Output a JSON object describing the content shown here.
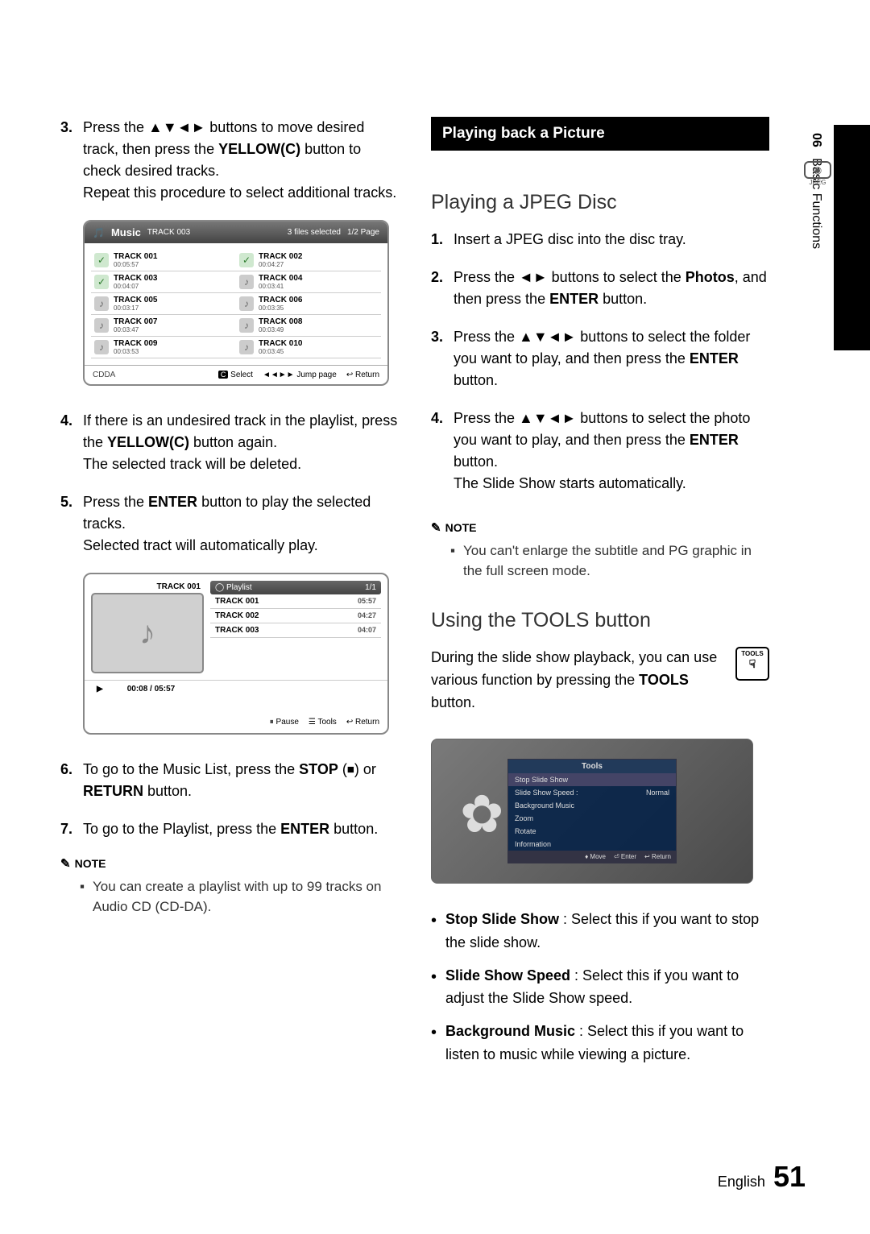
{
  "side": {
    "chapter": "06",
    "title": "Basic Functions"
  },
  "left": {
    "steps": [
      {
        "n": "3.",
        "html": "Press the ▲▼◄► buttons to move desired track, then press the <b>YELLOW(C)</b> button to check desired tracks.<br>Repeat this procedure to select additional tracks."
      },
      {
        "n": "4.",
        "html": "If there is an undesired track in the playlist, press the <b>YELLOW(C)</b> button again.<br>The selected track will be deleted."
      },
      {
        "n": "5.",
        "html": "Press the <b>ENTER</b> button to play the selected tracks.<br>Selected tract will automatically play."
      },
      {
        "n": "6.",
        "html": "To go to the Music List, press the <b>STOP</b> (⏹) or <b>RETURN</b> button."
      },
      {
        "n": "7.",
        "html": "To go to the Playlist, press the <b>ENTER</b> button."
      }
    ],
    "fig1": {
      "music": "Music",
      "cur": "TRACK 003",
      "sel": "3 files selected",
      "page": "1/2 Page",
      "tracks": [
        {
          "n": "TRACK 001",
          "t": "00:05:57",
          "c": true
        },
        {
          "n": "TRACK 002",
          "t": "00:04:27",
          "c": true
        },
        {
          "n": "TRACK 003",
          "t": "00:04:07",
          "c": true
        },
        {
          "n": "TRACK 004",
          "t": "00:03:41",
          "c": false
        },
        {
          "n": "TRACK 005",
          "t": "00:03:17",
          "c": false
        },
        {
          "n": "TRACK 006",
          "t": "00:03:35",
          "c": false
        },
        {
          "n": "TRACK 007",
          "t": "00:03:47",
          "c": false
        },
        {
          "n": "TRACK 008",
          "t": "00:03:49",
          "c": false
        },
        {
          "n": "TRACK 009",
          "t": "00:03:53",
          "c": false
        },
        {
          "n": "TRACK 010",
          "t": "00:03:45",
          "c": false
        }
      ],
      "cdda": "CDDA",
      "select": "Select",
      "jump": "Jump page",
      "ret": "Return"
    },
    "fig2": {
      "cur": "TRACK 001",
      "pl_hdr": "Playlist",
      "pl_page": "1/1",
      "items": [
        {
          "n": "TRACK 001",
          "t": "05:57"
        },
        {
          "n": "TRACK 002",
          "t": "04:27"
        },
        {
          "n": "TRACK 003",
          "t": "04:07"
        }
      ],
      "play_time": "00:08 / 05:57",
      "pause": "Pause",
      "tools": "Tools",
      "ret": "Return"
    },
    "note_hdr": "NOTE",
    "note": "You can create a playlist with up to 99 tracks on Audio CD (CD-DA)."
  },
  "right": {
    "bar": "Playing back a Picture",
    "jpeg_lbl": "JPEG",
    "h1": "Playing a JPEG Disc",
    "steps": [
      {
        "n": "1.",
        "html": "Insert a JPEG disc into the disc tray."
      },
      {
        "n": "2.",
        "html": "Press the ◄► buttons to select the <b>Photos</b>, and then press the <b>ENTER</b> button."
      },
      {
        "n": "3.",
        "html": "Press the ▲▼◄► buttons to select the folder you want to play, and then press the <b>ENTER</b> button."
      },
      {
        "n": "4.",
        "html": "Press the ▲▼◄► buttons to select the photo you want to play, and then press the <b>ENTER</b> button.<br>The Slide Show starts automatically."
      }
    ],
    "note_hdr": "NOTE",
    "note": "You can't enlarge the subtitle and PG graphic in the full screen mode.",
    "h2": "Using the TOOLS button",
    "tools_btn": "TOOLS",
    "para": "During the slide show playback, you can use various function by pressing the <b>TOOLS</b> button.",
    "fig3": {
      "hdr": "Tools",
      "items": [
        {
          "l": "Stop Slide Show",
          "r": ""
        },
        {
          "l": "Slide Show Speed :",
          "r": "Normal"
        },
        {
          "l": "Background Music",
          "r": ""
        },
        {
          "l": "Zoom",
          "r": ""
        },
        {
          "l": "Rotate",
          "r": ""
        },
        {
          "l": "Information",
          "r": ""
        }
      ],
      "move": "Move",
      "enter": "Enter",
      "ret": "Return"
    },
    "bullets": [
      "<b>Stop Slide Show</b> : Select this if you want to stop the slide show.",
      "<b>Slide Show Speed</b> : Select this if you want to adjust the Slide Show speed.",
      "<b>Background Music</b> : Select this if you want to listen to music while viewing a picture."
    ]
  },
  "footer": {
    "lang": "English",
    "page": "51"
  }
}
